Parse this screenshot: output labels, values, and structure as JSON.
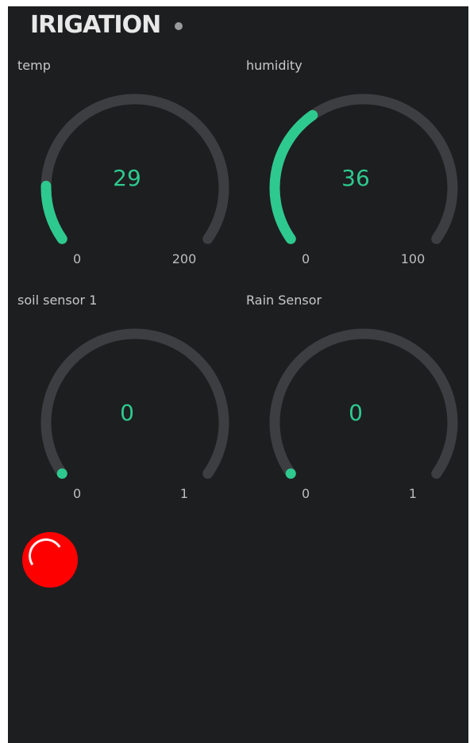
{
  "header": {
    "title": "IRIGATION"
  },
  "colors": {
    "background": "#1d1e20",
    "track": "#3d3e41",
    "accent": "#2ec98e",
    "led": "#ff0000",
    "status_dot": "#9a9a9a"
  },
  "gauges": [
    {
      "label": "temp",
      "value": "29",
      "min": "0",
      "max": "200"
    },
    {
      "label": "humidity",
      "value": "36",
      "min": "0",
      "max": "100"
    },
    {
      "label": "soil sensor 1",
      "value": "0",
      "min": "0",
      "max": "1"
    },
    {
      "label": "Rain Sensor",
      "value": "0",
      "min": "0",
      "max": "1"
    }
  ],
  "led_button": {
    "icon": "led-indicator-icon",
    "state": "on",
    "color": "#ff0000"
  }
}
